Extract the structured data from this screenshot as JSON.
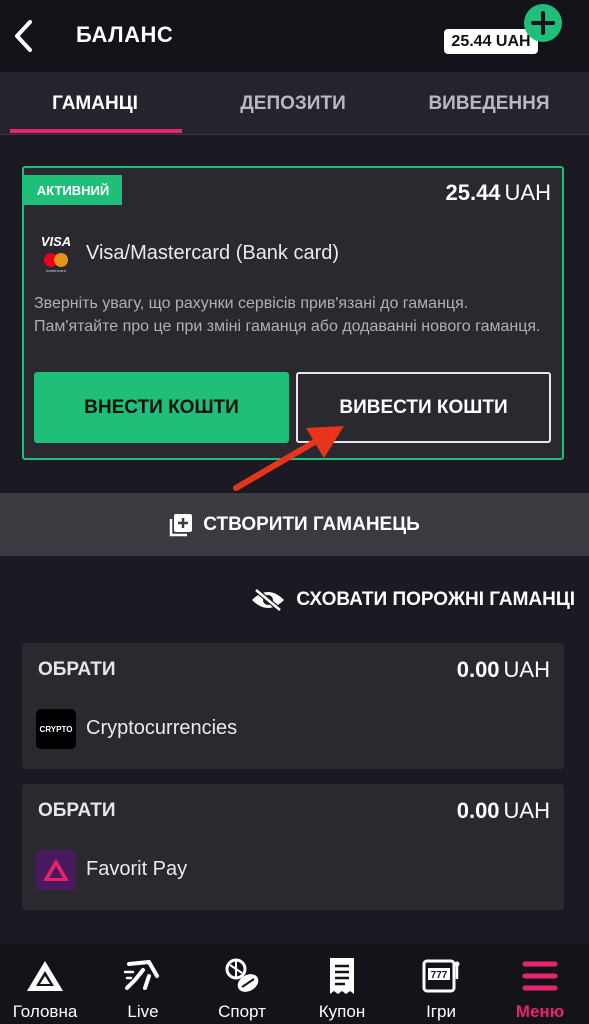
{
  "header": {
    "title": "БАЛАНС",
    "balance": "25.44 UAH"
  },
  "tabs": [
    {
      "label": "ГАМАНЦІ",
      "active": true
    },
    {
      "label": "ДЕПОЗИТИ",
      "active": false
    },
    {
      "label": "ВИВЕДЕННЯ",
      "active": false
    }
  ],
  "active_wallet": {
    "badge": "АКТИВНИЙ",
    "amount": "25.44",
    "currency": "UAH",
    "method": "Visa/Mastercard (Bank card)",
    "card_brand_text": "VISA",
    "card_sub_text": "mastercard",
    "notice": "Зверніть увагу, що рахунки сервісів прив'язані до гаманця. Пам'ятайте про це при зміні гаманця або додаванні нового гаманця.",
    "deposit_label": "ВНЕСТИ КОШТИ",
    "withdraw_label": "ВИВЕСТИ КОШТИ"
  },
  "create_wallet_label": "СТВОРИТИ ГАМАНЕЦЬ",
  "hide_empty_label": "СХОВАТИ ПОРОЖНІ ГАМАНЦІ",
  "wallets": [
    {
      "select_label": "ОБРАТИ",
      "amount": "0.00",
      "currency": "UAH",
      "name": "Cryptocurrencies",
      "icon_text": "CRYPTO",
      "icon": "crypto-icon"
    },
    {
      "select_label": "ОБРАТИ",
      "amount": "0.00",
      "currency": "UAH",
      "name": "Favorit Pay",
      "icon": "favorit-pay-icon"
    }
  ],
  "nav": [
    {
      "label": "Головна",
      "icon": "home-logo-icon",
      "active": false
    },
    {
      "label": "Live",
      "icon": "live-runner-icon",
      "active": false
    },
    {
      "label": "Спорт",
      "icon": "sport-balls-icon",
      "active": false
    },
    {
      "label": "Купон",
      "icon": "coupon-icon",
      "active": false
    },
    {
      "label": "Ігри",
      "icon": "slot-machine-icon",
      "active": false
    },
    {
      "label": "Меню",
      "icon": "menu-icon",
      "active": true
    }
  ],
  "colors": {
    "accent_green": "#1fbf7a",
    "accent_pink": "#e9246f",
    "arrow_red": "#e8341c",
    "background": "#1b1a22"
  }
}
